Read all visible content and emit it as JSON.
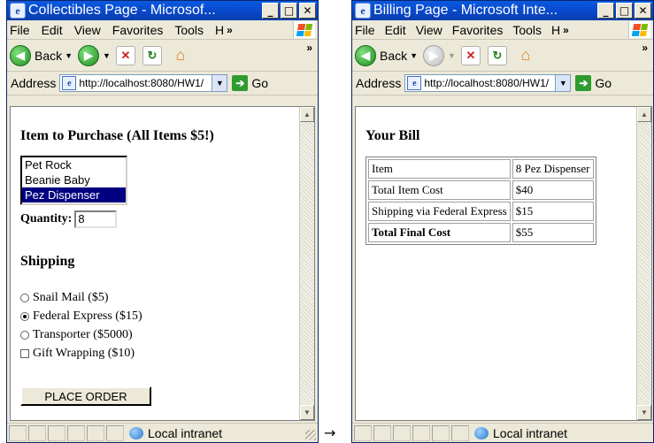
{
  "left_window": {
    "title": "Collectibles Page - Microsof...",
    "menu": [
      "File",
      "Edit",
      "View",
      "Favorites",
      "Tools",
      "H"
    ],
    "menu_more": "»",
    "back_label": "Back",
    "toolbar_more": "»",
    "address_label": "Address",
    "address_url": "http://localhost:8080/HW1/",
    "go_label": "Go",
    "page": {
      "heading": "Item to Purchase (All Items $5!)",
      "items": [
        "Pet Rock",
        "Beanie Baby",
        "Pez Dispenser"
      ],
      "selected_index": 2,
      "quantity_label": "Quantity:",
      "quantity_value": "8",
      "shipping_heading": "Shipping",
      "shipping_options": [
        {
          "label": "Snail Mail ($5)",
          "checked": false
        },
        {
          "label": "Federal Express ($15)",
          "checked": true
        },
        {
          "label": "Transporter ($5000)",
          "checked": false
        }
      ],
      "gift_wrapping": {
        "label": "Gift Wrapping ($10)",
        "checked": false
      },
      "button_label": "PLACE ORDER"
    },
    "status_zone": "Local intranet"
  },
  "arrow": "→",
  "right_window": {
    "title": "Billing Page - Microsoft Inte...",
    "menu": [
      "File",
      "Edit",
      "View",
      "Favorites",
      "Tools",
      "H"
    ],
    "menu_more": "»",
    "back_label": "Back",
    "toolbar_more": "»",
    "address_label": "Address",
    "address_url": "http://localhost:8080/HW1/",
    "go_label": "Go",
    "page": {
      "heading": "Your Bill",
      "rows": [
        {
          "label": "Item",
          "value": "8 Pez Dispenser"
        },
        {
          "label": "Total Item Cost",
          "value": "$40"
        },
        {
          "label": "Shipping via Federal Express",
          "value": "$15"
        },
        {
          "label": "Total Final Cost",
          "value": "$55"
        }
      ]
    },
    "status_zone": "Local intranet"
  }
}
